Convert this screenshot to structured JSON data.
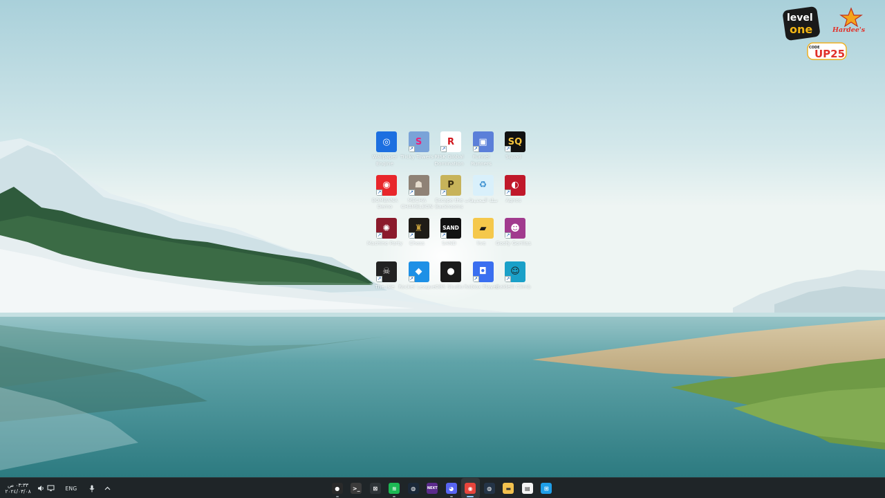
{
  "desktop": {
    "icons": [
      {
        "label": "Wallpaper Engine",
        "icon": "wallpaper-engine-icon",
        "bg": "#1d6fe0",
        "glyph": "◎",
        "fg": "#ffffff",
        "shortcut": false
      },
      {
        "label": "Tricky Towers",
        "icon": "tricky-towers-icon",
        "bg": "#7aa3d8",
        "glyph": "S",
        "fg": "#e8207a",
        "shortcut": true
      },
      {
        "label": "RISK Global Domination",
        "icon": "risk-icon",
        "bg": "#ffffff",
        "glyph": "R",
        "fg": "#d0151c",
        "shortcut": true
      },
      {
        "label": "Funnel Runners",
        "icon": "funnel-runners-icon",
        "bg": "#5b7fd9",
        "glyph": "▣",
        "fg": "#ffffff",
        "shortcut": true
      },
      {
        "label": "Squad",
        "icon": "squad-icon",
        "bg": "#111111",
        "glyph": "SQ",
        "fg": "#f5c33b",
        "shortcut": true
      },
      {
        "label": "BOMBANA Demo",
        "icon": "bombana-icon",
        "bg": "#e8262b",
        "glyph": "◉",
        "fg": "#ffffff",
        "shortcut": true
      },
      {
        "label": "MECHA CHAMELEON",
        "icon": "mecha-chameleon-icon",
        "bg": "#8f8276",
        "glyph": "☗",
        "fg": "#e6dccd",
        "shortcut": true
      },
      {
        "label": "Escape the Backrooms",
        "icon": "escape-backrooms-icon",
        "bg": "#c7b35a",
        "glyph": "P",
        "fg": "#3a2e10",
        "shortcut": true
      },
      {
        "label": "سلة المحذوفات",
        "icon": "recycle-bin-icon",
        "bg": "#d9f0fb",
        "glyph": "♻",
        "fg": "#3a8fd0",
        "shortcut": false
      },
      {
        "label": "Agnos",
        "icon": "agnos-icon",
        "bg": "#c0182a",
        "glyph": "◐",
        "fg": "#ffffff",
        "shortcut": true
      },
      {
        "label": "Machine Party",
        "icon": "machine-party-icon",
        "bg": "#8b1a2b",
        "glyph": "✺",
        "fg": "#ffffff",
        "shortcut": true
      },
      {
        "label": "Chess",
        "icon": "chess-icon",
        "bg": "#1f1c17",
        "glyph": "♜",
        "fg": "#c8a23c",
        "shortcut": true
      },
      {
        "label": "SAND",
        "icon": "sand-icon",
        "bg": "#121212",
        "glyph": "SAND",
        "fg": "#ffffff",
        "shortcut": true
      },
      {
        "label": "live",
        "icon": "folder-icon",
        "bg": "#f5c84b",
        "glyph": "▰",
        "fg": "#1a1a1a",
        "shortcut": false
      },
      {
        "label": "Goofy Gorillas",
        "icon": "goofy-gorillas-icon",
        "bg": "#a13b8e",
        "glyph": "☻",
        "fg": "#ffffff",
        "shortcut": true
      },
      {
        "label": "The Isle",
        "icon": "the-isle-icon",
        "bg": "#222222",
        "glyph": "☠",
        "fg": "#d8d8d8",
        "shortcut": true
      },
      {
        "label": "Rocket League",
        "icon": "rocket-league-icon",
        "bg": "#1e90e6",
        "glyph": "◆",
        "fg": "#ffffff",
        "shortcut": true
      },
      {
        "label": "OBS Studio",
        "icon": "obs-studio-icon",
        "bg": "#1b1b1b",
        "glyph": "●",
        "fg": "#ffffff",
        "shortcut": false
      },
      {
        "label": "Roblox Player",
        "icon": "roblox-icon",
        "bg": "#3a6ff0",
        "glyph": "◘",
        "fg": "#ffffff",
        "shortcut": true
      },
      {
        "label": "Baldelli Climb",
        "icon": "climb-game-icon",
        "bg": "#1aa0c8",
        "glyph": "☺",
        "fg": "#1a1a1a",
        "shortcut": true
      }
    ]
  },
  "branding": {
    "level_one_line1": "level",
    "level_one_line2": "one",
    "hardees": "Hardee's",
    "code_label": "CODE",
    "code_value": "UP25"
  },
  "taskbar": {
    "clock_time": "٠٣:٣٣ ص",
    "clock_date": "٢٠٢٤/٠٣/٠٨",
    "language": "ENG",
    "apps": [
      {
        "name": "obs-taskbar-icon",
        "glyph": "●",
        "bg": "#2a2a2a",
        "running": true,
        "active": false
      },
      {
        "name": "terminal-taskbar-icon",
        "glyph": ">_",
        "bg": "#3b3b3b",
        "running": false,
        "active": false
      },
      {
        "name": "capture-taskbar-icon",
        "glyph": "⊠",
        "bg": "#2e3438",
        "running": false,
        "active": false
      },
      {
        "name": "spotify-taskbar-icon",
        "glyph": "≋",
        "bg": "#1db954",
        "running": true,
        "active": false
      },
      {
        "name": "steam-taskbar-icon",
        "glyph": "◍",
        "bg": "#1b2838",
        "running": false,
        "active": false
      },
      {
        "name": "next-taskbar-icon",
        "glyph": "NEXT",
        "bg": "#5b2b8c",
        "running": false,
        "active": false
      },
      {
        "name": "discord-taskbar-icon",
        "glyph": "◕",
        "bg": "#5865f2",
        "running": true,
        "active": false
      },
      {
        "name": "chrome-taskbar-icon",
        "glyph": "◉",
        "bg": "#e8453c",
        "running": true,
        "active": true
      },
      {
        "name": "steam-alt-taskbar-icon",
        "glyph": "◍",
        "bg": "#243447",
        "running": false,
        "active": false
      },
      {
        "name": "file-explorer-taskbar-icon",
        "glyph": "▬",
        "bg": "#f2c14e",
        "running": false,
        "active": false
      },
      {
        "name": "notepad-taskbar-icon",
        "glyph": "▤",
        "bg": "#f4f4f4",
        "running": false,
        "active": false
      },
      {
        "name": "windows-start-icon",
        "glyph": "⊞",
        "bg": "#1f9ee8",
        "running": false,
        "active": false
      }
    ]
  }
}
